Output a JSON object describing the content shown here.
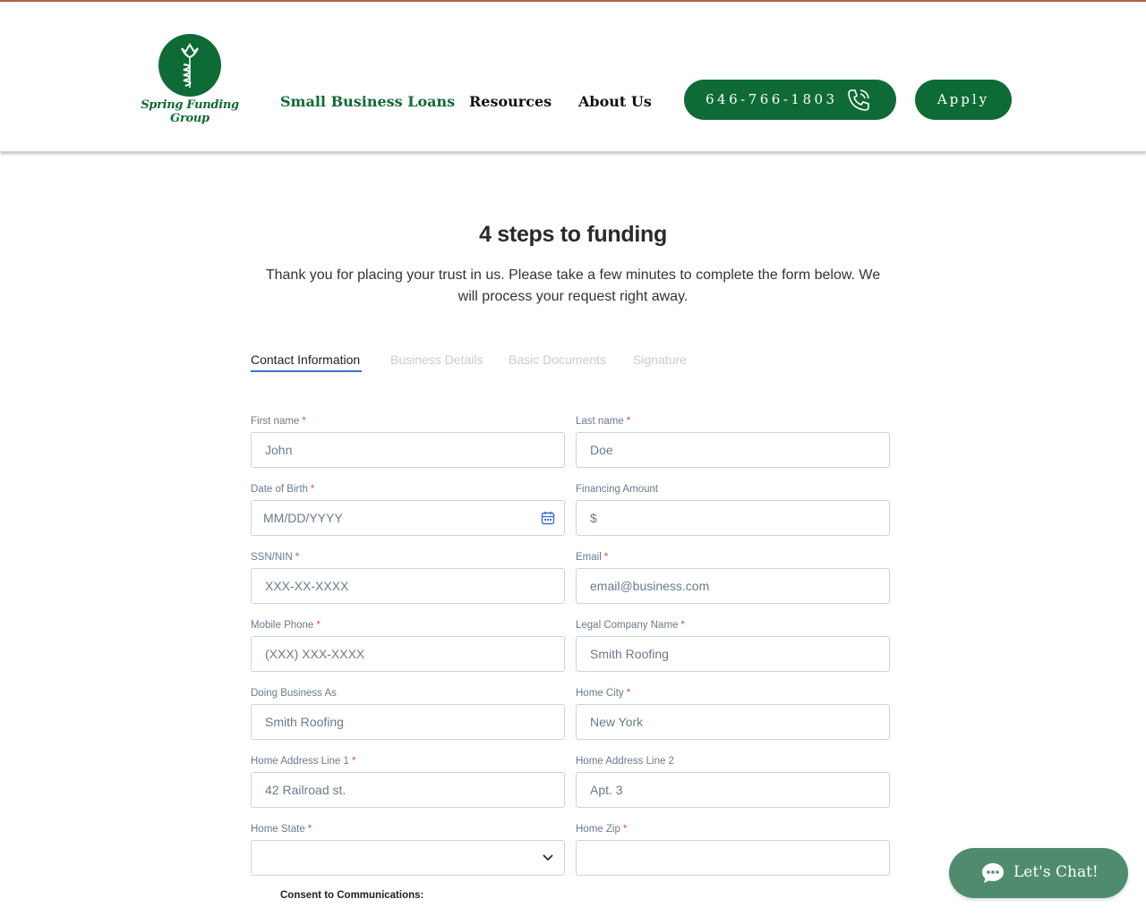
{
  "header": {
    "logo_text": "Spring Funding Group",
    "nav": [
      {
        "label": "Small Business Loans"
      },
      {
        "label": "Resources"
      },
      {
        "label": "About Us"
      }
    ],
    "phone_label": "646-766-1803",
    "apply_label": "Apply",
    "brand_color": "#0f6b35"
  },
  "main": {
    "title": "4 steps to funding",
    "intro": "Thank you for placing your trust in us. Please take a few minutes to complete the form below. We will process your request right away.",
    "tabs": [
      {
        "label": "Contact Information",
        "active": true
      },
      {
        "label": "Business Details",
        "active": false
      },
      {
        "label": "Basic Documents",
        "active": false
      },
      {
        "label": "Signature",
        "active": false
      }
    ]
  },
  "form": {
    "first_name": {
      "label": "First name",
      "required_mark": "*",
      "placeholder": "John"
    },
    "last_name": {
      "label": "Last name",
      "required_mark": "*",
      "placeholder": "Doe"
    },
    "dob": {
      "label": "Date of Birth",
      "required_mark": "*",
      "placeholder": "MM/DD/YYYY"
    },
    "financing_amount": {
      "label": "Financing Amount",
      "placeholder": "$"
    },
    "ssn": {
      "label": "SSN/NIN",
      "required_mark": "*",
      "placeholder": "XXX-XX-XXXX"
    },
    "email": {
      "label": "Email",
      "required_mark": "*",
      "placeholder": "email@business.com"
    },
    "mobile": {
      "label": "Mobile Phone",
      "required_mark": "*",
      "placeholder": "(XXX) XXX-XXXX"
    },
    "company": {
      "label": "Legal Company Name",
      "required_mark": "*",
      "placeholder": "Smith Roofing"
    },
    "dba": {
      "label": "Doing Business As",
      "placeholder": "Smith Roofing"
    },
    "city": {
      "label": "Home City",
      "required_mark": "*",
      "placeholder": "New York"
    },
    "address1": {
      "label": "Home Address Line 1",
      "required_mark": "*",
      "placeholder": "42 Railroad st."
    },
    "address2": {
      "label": "Home Address Line 2",
      "placeholder": "Apt. 3"
    },
    "state": {
      "label": "Home State",
      "required_mark": "*",
      "value": ""
    },
    "zip": {
      "label": "Home Zip",
      "required_mark": "*",
      "placeholder": ""
    },
    "consent_label": "Consent to Communications:"
  },
  "chat": {
    "label": "Let's Chat!",
    "color": "#4f8c6e"
  }
}
